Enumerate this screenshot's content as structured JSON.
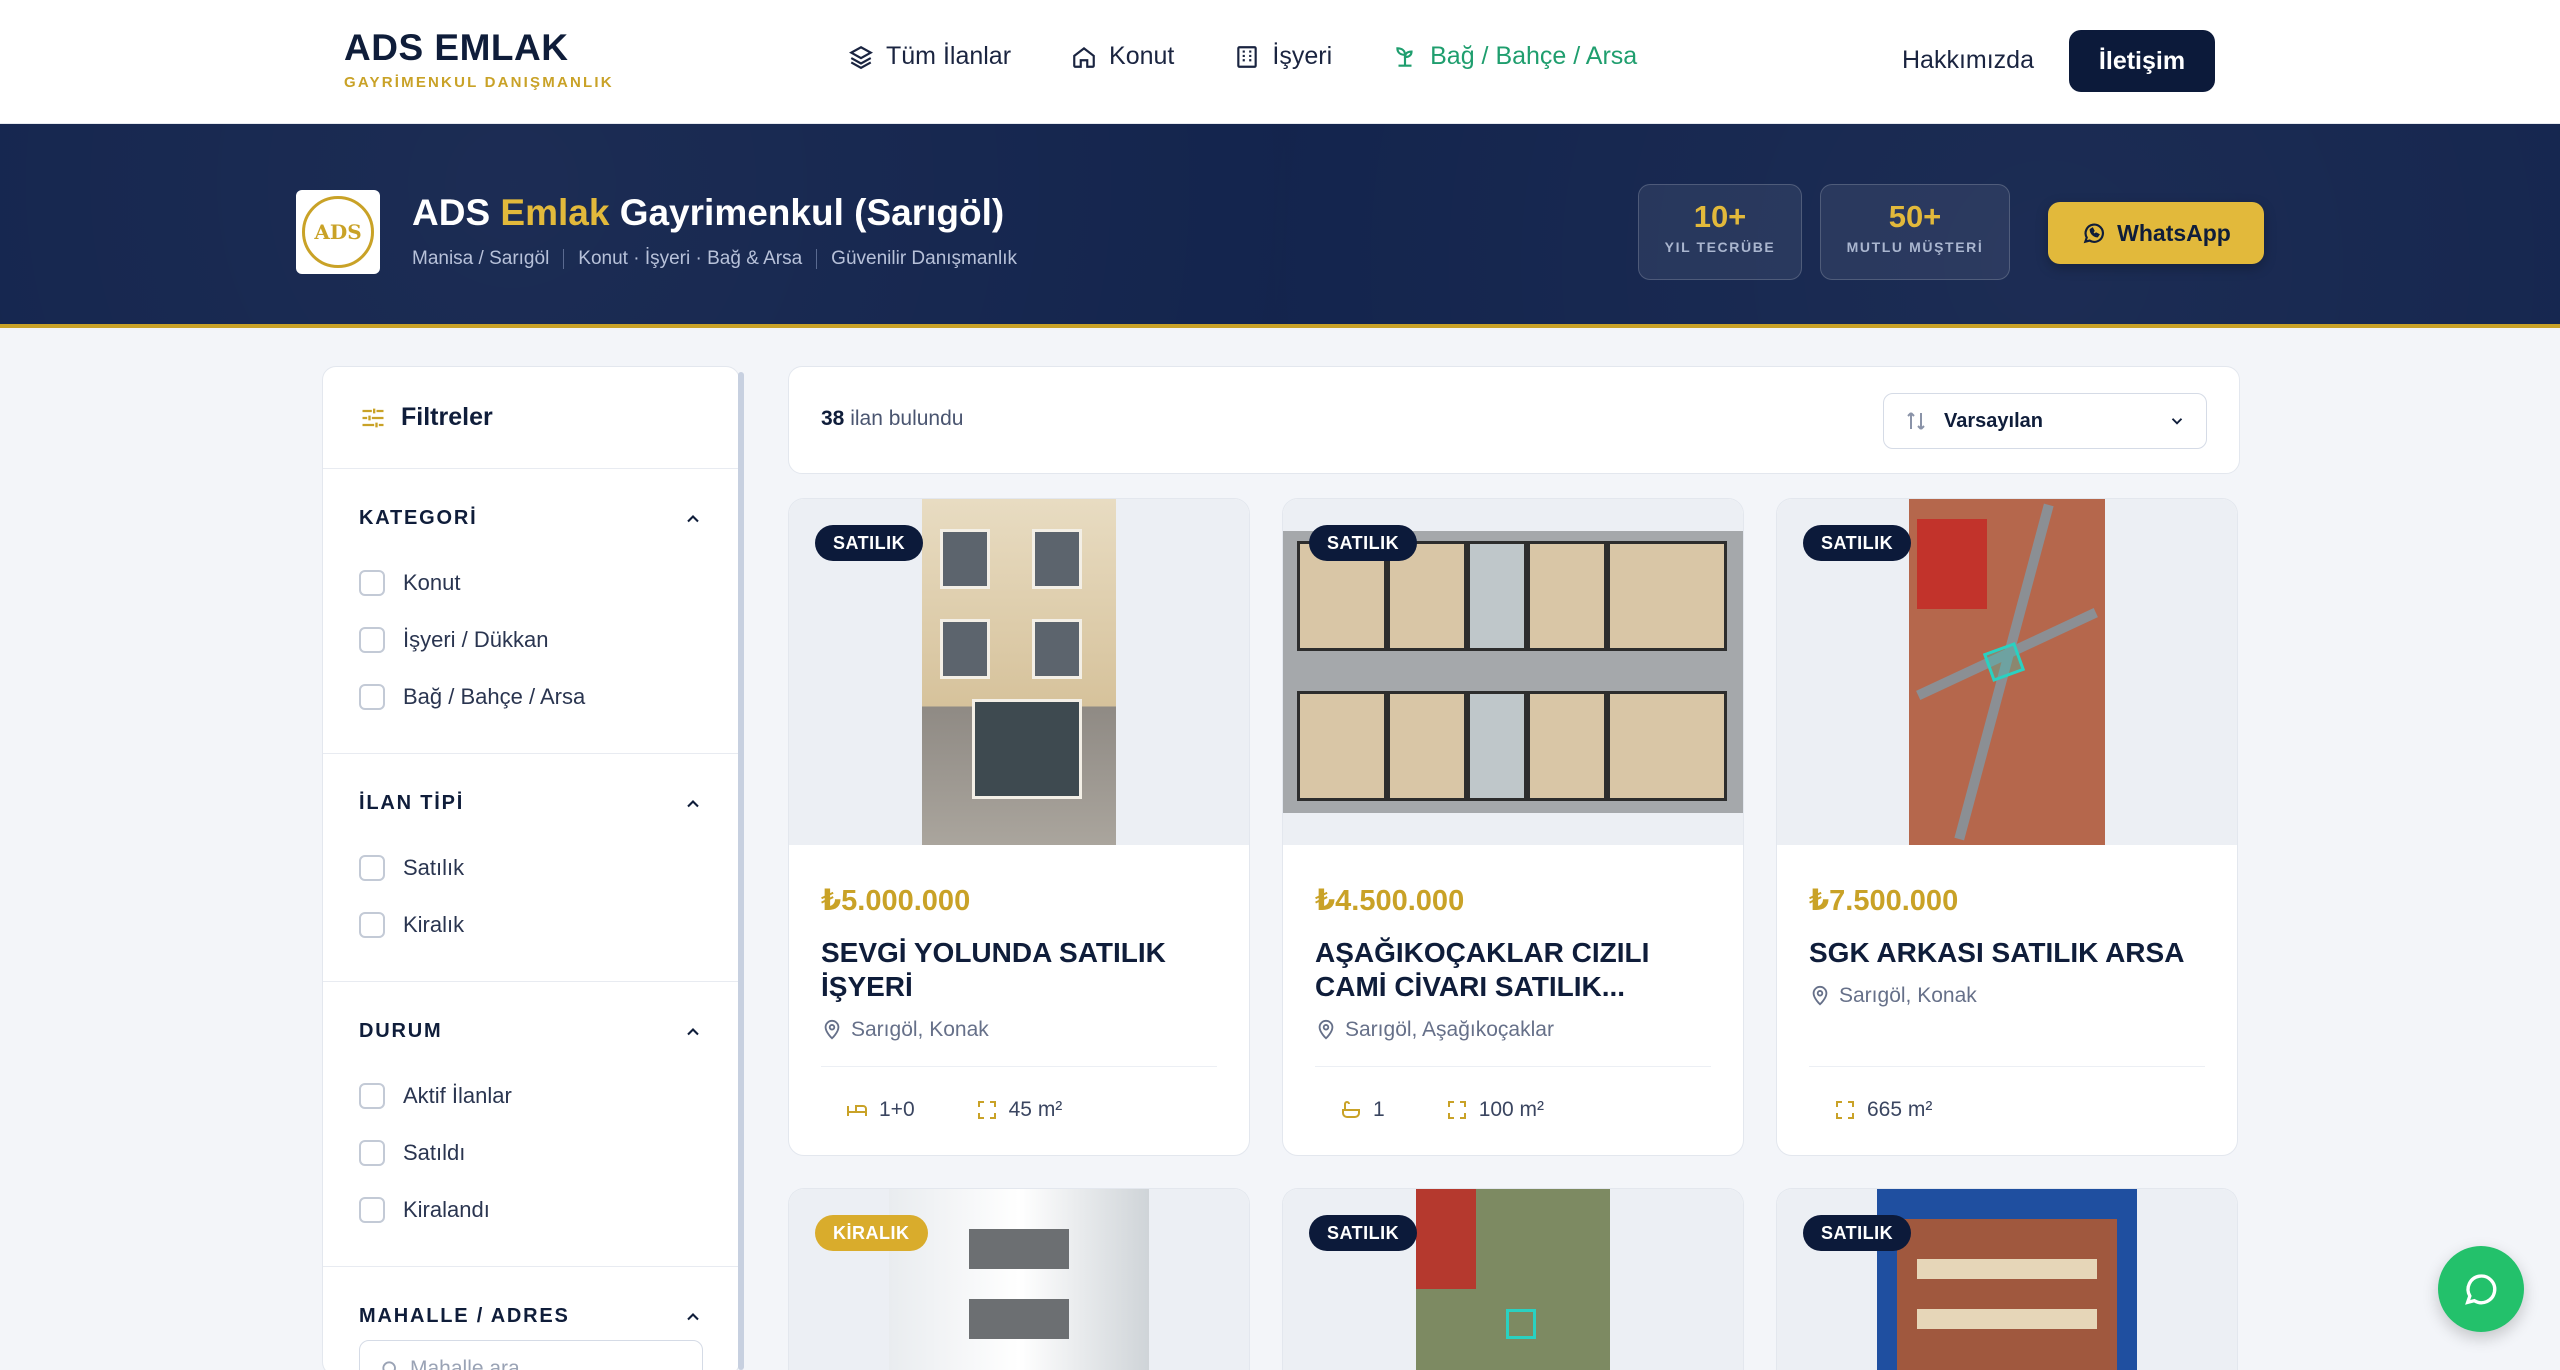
{
  "brand": {
    "title": "ADS EMLAK",
    "subtitle": "GAYRİMENKUL DANIŞMANLIK"
  },
  "nav": {
    "items": [
      {
        "label": "Tüm İlanlar",
        "icon": "layers-icon"
      },
      {
        "label": "Konut",
        "icon": "home-icon"
      },
      {
        "label": "İşyeri",
        "icon": "building-icon"
      },
      {
        "label": "Bağ / Bahçe / Arsa",
        "icon": "sprout-icon",
        "active": true
      }
    ],
    "about": "Hakkımızda",
    "contact": "İletişim"
  },
  "banner": {
    "logo_text": "ADS",
    "title_a": "ADS",
    "title_b": "Emlak",
    "title_c": "Gayrimenkul (Sarıgöl)",
    "sub1": "Manisa / Sarıgöl",
    "sub2": "Konut · İşyeri · Bağ & Arsa",
    "sub3": "Güvenilir Danışmanlık",
    "stat1_num": "10+",
    "stat1_lbl": "YIL TECRÜBE",
    "stat2_num": "50+",
    "stat2_lbl": "MUTLU MÜŞTERİ",
    "whatsapp": "WhatsApp"
  },
  "filters": {
    "title": "Filtreler",
    "category": {
      "title": "KATEGORİ",
      "options": [
        "Konut",
        "İşyeri / Dükkan",
        "Bağ / Bahçe / Arsa"
      ]
    },
    "type": {
      "title": "İLAN TİPİ",
      "options": [
        "Satılık",
        "Kiralık"
      ]
    },
    "status": {
      "title": "DURUM",
      "options": [
        "Aktif İlanlar",
        "Satıldı",
        "Kiralandı"
      ]
    },
    "address": {
      "title": "MAHALLE / ADRES",
      "placeholder": "Mahalle ara..."
    }
  },
  "results": {
    "count": "38",
    "count_suffix": "ilan bulundu",
    "sort": "Varsayılan"
  },
  "listings": [
    {
      "badge": "SATILIK",
      "price": "₺5.000.000",
      "title": "SEVGİ YOLUNDA SATILIK İŞYERİ",
      "location": "Sarıgöl, Konak",
      "rooms": "1+0",
      "area": "45 m²"
    },
    {
      "badge": "SATILIK",
      "price": "₺4.500.000",
      "title": "AŞAĞIKOÇAKLAR CIZILI CAMİ CİVARI SATILIK...",
      "location": "Sarıgöl, Aşağıkoçaklar",
      "rooms": "1",
      "area": "100 m²"
    },
    {
      "badge": "SATILIK",
      "price": "₺7.500.000",
      "title": "SGK ARKASI SATILIK ARSA",
      "location": "Sarıgöl, Konak",
      "area": "665 m²"
    },
    {
      "badge": "KİRALIK"
    },
    {
      "badge": "SATILIK"
    },
    {
      "badge": "SATILIK"
    }
  ],
  "colors": {
    "navy": "#0c1a3a",
    "gold": "#c9a227",
    "green": "#1f9e6e",
    "whatsapp": "#23c16b"
  }
}
